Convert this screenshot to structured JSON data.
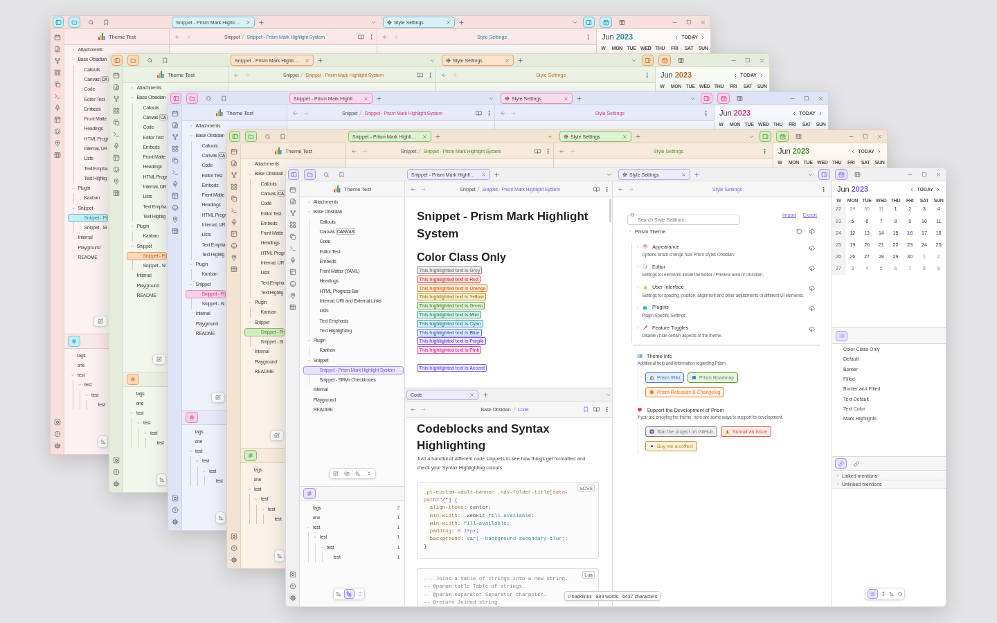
{
  "windows": [
    {
      "tab_bar": {
        "left_buttons": [
          {
            "selected": true
          },
          {
            "selected": true
          },
          {
            "selected": false
          },
          {
            "selected": false
          }
        ],
        "main_tab": "Snippet - Prism Mark Highli…",
        "side_tab": "Style Settings",
        "right_buttons": [
          {
            "selected": true
          },
          {
            "selected": true
          },
          {
            "selected": false
          }
        ]
      },
      "explorer": {
        "title": "Theme Test",
        "tree": [
          {
            "label": "Attachments",
            "expanded": false,
            "selected": false
          },
          {
            "label": "Base Obsidian",
            "expanded": true,
            "selected": false,
            "children": [
              {
                "label": "Callouts",
                "selected": false
              },
              {
                "label": "Canvas",
                "badge": "CA",
                "selected": false
              },
              {
                "label": "Code",
                "selected": false
              },
              {
                "label": "Editor Test",
                "selected": false
              },
              {
                "label": "Embeds",
                "selected": false
              },
              {
                "label": "Front Matte",
                "selected": false
              },
              {
                "label": "Headings",
                "selected": false
              },
              {
                "label": "HTML Progr",
                "selected": false
              },
              {
                "label": "Internal, UR",
                "selected": false
              },
              {
                "label": "Lists",
                "selected": false
              },
              {
                "label": "Text Empha",
                "selected": false
              },
              {
                "label": "Text Highlig",
                "selected": false
              }
            ]
          },
          {
            "label": "Plugin",
            "expanded": true,
            "selected": false,
            "children": [
              {
                "label": "Kanban",
                "selected": false
              }
            ]
          },
          {
            "label": "Snippet",
            "expanded": true,
            "selected": false,
            "children": [
              {
                "label": "Snippet - Pr",
                "selected": true
              },
              {
                "label": "Snippet - Sl",
                "selected": false
              }
            ]
          },
          {
            "label": "Internal",
            "selected": false
          },
          {
            "label": "Playground",
            "selected": false
          },
          {
            "label": "README",
            "selected": false
          }
        ]
      },
      "tags": {
        "tree": [
          {
            "label": "tags"
          },
          {
            "label": "one"
          },
          {
            "label": "test",
            "expanded": true,
            "children": [
              {
                "label": "test",
                "expanded": true,
                "children": [
                  {
                    "label": "test",
                    "expanded": true,
                    "children": [
                      {
                        "label": "test"
                      }
                    ]
                  }
                ]
              }
            ]
          }
        ],
        "toolbar": [
          {
            "selected": false
          }
        ]
      },
      "editor": {
        "breadcrumb": [
          "Snippet",
          "Snippet - Prism Mark Highlight System"
        ]
      },
      "settings": {
        "title": "Style Settings"
      },
      "calendar": {
        "month": "Jun",
        "year": "2023",
        "today": "TODAY",
        "weekdays": [
          "W",
          "MON",
          "TUE",
          "WED",
          "THU",
          "FRI",
          "SAT",
          "SUN"
        ]
      }
    },
    {
      "tab_bar": {
        "left_buttons": [
          {
            "selected": true
          },
          {
            "selected": true
          },
          {
            "selected": false
          },
          {
            "selected": false
          }
        ],
        "main_tab": "Snippet - Prism Mark Highli…",
        "side_tab": "Style Settings",
        "right_buttons": [
          {
            "selected": true
          },
          {
            "selected": true
          },
          {
            "selected": false
          }
        ]
      },
      "explorer": {
        "title": "Theme Test",
        "tree": [
          {
            "label": "Attachments",
            "expanded": false,
            "selected": false
          },
          {
            "label": "Base Obsidian",
            "expanded": true,
            "selected": false,
            "children": [
              {
                "label": "Callouts",
                "selected": false
              },
              {
                "label": "Canvas",
                "badge": "CA",
                "selected": false
              },
              {
                "label": "Code",
                "selected": false
              },
              {
                "label": "Editor Test",
                "selected": false
              },
              {
                "label": "Embeds",
                "selected": false
              },
              {
                "label": "Front Matte",
                "selected": false
              },
              {
                "label": "Headings",
                "selected": false
              },
              {
                "label": "HTML Progr",
                "selected": false
              },
              {
                "label": "Internal, UR",
                "selected": false
              },
              {
                "label": "Lists",
                "selected": false
              },
              {
                "label": "Text Empha",
                "selected": false
              },
              {
                "label": "Text Highlig",
                "selected": false
              }
            ]
          },
          {
            "label": "Plugin",
            "expanded": true,
            "selected": false,
            "children": [
              {
                "label": "Kanban",
                "selected": false
              }
            ]
          },
          {
            "label": "Snippet",
            "expanded": true,
            "selected": false,
            "children": [
              {
                "label": "Snippet - Pr",
                "selected": true
              },
              {
                "label": "Snippet - Sl",
                "selected": false
              }
            ]
          },
          {
            "label": "Internal",
            "selected": false
          },
          {
            "label": "Playground",
            "selected": false
          },
          {
            "label": "README",
            "selected": false
          }
        ]
      },
      "tags": {
        "tree": [
          {
            "label": "tags"
          },
          {
            "label": "one"
          },
          {
            "label": "test",
            "expanded": true,
            "children": [
              {
                "label": "test",
                "expanded": true,
                "children": [
                  {
                    "label": "test",
                    "expanded": true,
                    "children": [
                      {
                        "label": "test"
                      }
                    ]
                  }
                ]
              }
            ]
          }
        ],
        "toolbar": [
          {
            "selected": false
          }
        ]
      },
      "editor": {
        "breadcrumb": [
          "Snippet",
          "Snippet - Prism Mark Highlight System"
        ]
      },
      "settings": {
        "title": "Style Settings"
      },
      "calendar": {
        "month": "Jun",
        "year": "2023",
        "today": "TODAY",
        "weekdays": [
          "W",
          "MON",
          "TUE",
          "WED",
          "THU",
          "FRI",
          "SAT",
          "SUN"
        ]
      }
    },
    {
      "tab_bar": {
        "left_buttons": [
          {
            "selected": true
          },
          {
            "selected": true
          },
          {
            "selected": false
          },
          {
            "selected": false
          }
        ],
        "main_tab": "Snippet - Prism Mark Highli…",
        "side_tab": "Style Settings",
        "right_buttons": [
          {
            "selected": true
          },
          {
            "selected": true
          },
          {
            "selected": false
          }
        ]
      },
      "explorer": {
        "title": "Theme Test",
        "tree": [
          {
            "label": "Attachments",
            "expanded": false,
            "selected": false
          },
          {
            "label": "Base Obsidian",
            "expanded": true,
            "selected": false,
            "children": [
              {
                "label": "Callouts",
                "selected": false
              },
              {
                "label": "Canvas",
                "badge": "CA",
                "selected": false
              },
              {
                "label": "Code",
                "selected": false
              },
              {
                "label": "Editor Test",
                "selected": false
              },
              {
                "label": "Embeds",
                "selected": false
              },
              {
                "label": "Front Matte",
                "selected": false
              },
              {
                "label": "Headings",
                "selected": false
              },
              {
                "label": "HTML Progr",
                "selected": false
              },
              {
                "label": "Internal, UR",
                "selected": false
              },
              {
                "label": "Lists",
                "selected": false
              },
              {
                "label": "Text Empha",
                "selected": false
              },
              {
                "label": "Text Highlig",
                "selected": false
              }
            ]
          },
          {
            "label": "Plugin",
            "expanded": true,
            "selected": false,
            "children": [
              {
                "label": "Kanban",
                "selected": false
              }
            ]
          },
          {
            "label": "Snippet",
            "expanded": true,
            "selected": false,
            "children": [
              {
                "label": "Snippet - Pr",
                "selected": true
              },
              {
                "label": "Snippet - Sl",
                "selected": false
              }
            ]
          },
          {
            "label": "Internal",
            "selected": false
          },
          {
            "label": "Playground",
            "selected": false
          },
          {
            "label": "README",
            "selected": false
          }
        ]
      },
      "tags": {
        "tree": [
          {
            "label": "tags"
          },
          {
            "label": "one"
          },
          {
            "label": "test",
            "expanded": true,
            "children": [
              {
                "label": "test",
                "expanded": true,
                "children": [
                  {
                    "label": "test",
                    "expanded": true,
                    "children": [
                      {
                        "label": "test"
                      }
                    ]
                  }
                ]
              }
            ]
          }
        ],
        "toolbar": [
          {
            "selected": false
          }
        ]
      },
      "editor": {
        "breadcrumb": [
          "Snippet",
          "Snippet - Prism Mark Highlight System"
        ]
      },
      "settings": {
        "title": "Style Settings"
      },
      "calendar": {
        "month": "Jun",
        "year": "2023",
        "today": "TODAY",
        "weekdays": [
          "W",
          "MON",
          "TUE",
          "WED",
          "THU",
          "FRI",
          "SAT",
          "SUN"
        ]
      }
    },
    {
      "tab_bar": {
        "left_buttons": [
          {
            "selected": true
          },
          {
            "selected": true
          },
          {
            "selected": false
          },
          {
            "selected": false
          }
        ],
        "main_tab": "Snippet - Prism Mark Highli…",
        "side_tab": "Style Settings",
        "right_buttons": [
          {
            "selected": true
          },
          {
            "selected": true
          },
          {
            "selected": false
          }
        ]
      },
      "explorer": {
        "title": "Theme Test",
        "tree": [
          {
            "label": "Attachments",
            "expanded": false,
            "selected": false
          },
          {
            "label": "Base Obsidian",
            "expanded": true,
            "selected": false,
            "children": [
              {
                "label": "Callouts",
                "selected": false
              },
              {
                "label": "Canvas",
                "badge": "CA",
                "selected": false
              },
              {
                "label": "Code",
                "selected": false
              },
              {
                "label": "Editor Test",
                "selected": false
              },
              {
                "label": "Embeds",
                "selected": false
              },
              {
                "label": "Front Matte",
                "selected": false
              },
              {
                "label": "Headings",
                "selected": false
              },
              {
                "label": "HTML Progr",
                "selected": false
              },
              {
                "label": "Internal, UR",
                "selected": false
              },
              {
                "label": "Lists",
                "selected": false
              },
              {
                "label": "Text Empha",
                "selected": false
              },
              {
                "label": "Text Highlig",
                "selected": false
              }
            ]
          },
          {
            "label": "Plugin",
            "expanded": true,
            "selected": false,
            "children": [
              {
                "label": "Kanban",
                "selected": false
              }
            ]
          },
          {
            "label": "Snippet",
            "expanded": true,
            "selected": false,
            "children": [
              {
                "label": "Snippet - Pr",
                "selected": true
              },
              {
                "label": "Snippet - Sl",
                "selected": false
              }
            ]
          },
          {
            "label": "Internal",
            "selected": false
          },
          {
            "label": "Playground",
            "selected": false
          },
          {
            "label": "README",
            "selected": false
          }
        ]
      },
      "tags": {
        "tree": [
          {
            "label": "tags"
          },
          {
            "label": "one"
          },
          {
            "label": "test",
            "expanded": true,
            "children": [
              {
                "label": "test",
                "expanded": true,
                "children": [
                  {
                    "label": "test",
                    "expanded": true,
                    "children": [
                      {
                        "label": "test"
                      }
                    ]
                  }
                ]
              }
            ]
          }
        ],
        "toolbar": [
          {
            "selected": false
          }
        ]
      },
      "editor": {
        "breadcrumb": [
          "Snippet",
          "Snippet - Prism Mark Highlight System"
        ]
      },
      "settings": {
        "title": "Style Settings"
      },
      "calendar": {
        "month": "Jun",
        "year": "2023",
        "today": "TODAY",
        "weekdays": [
          "W",
          "MON",
          "TUE",
          "WED",
          "THU",
          "FRI",
          "SAT",
          "SUN"
        ]
      }
    },
    {
      "tab_bar": {
        "left_buttons": [
          {
            "selected": true
          },
          {
            "selected": true
          },
          {
            "selected": false
          },
          {
            "selected": false
          }
        ],
        "main_tab": "Snippet - Prism Mark Highli…",
        "side_tab": "Style Settings",
        "right_buttons": [
          {
            "selected": true
          },
          {
            "selected": true
          },
          {
            "selected": false
          }
        ]
      },
      "explorer": {
        "title": "Theme Test",
        "tree": [
          {
            "label": "Attachments",
            "expanded": false,
            "selected": false
          },
          {
            "label": "Base Obsidian",
            "expanded": true,
            "selected": false,
            "children": [
              {
                "label": "Callouts",
                "selected": false
              },
              {
                "label": "Canvas",
                "badge": "CANVAS",
                "selected": false
              },
              {
                "label": "Code",
                "selected": false
              },
              {
                "label": "Editor Test",
                "selected": false
              },
              {
                "label": "Embeds",
                "selected": false
              },
              {
                "label": "Front Matter (YAML)",
                "selected": false
              },
              {
                "label": "Headings",
                "selected": false
              },
              {
                "label": "HTML Progress Bar",
                "selected": false
              },
              {
                "label": "Internal, URI and External Links",
                "selected": false
              },
              {
                "label": "Lists",
                "selected": false
              },
              {
                "label": "Text Emphasis",
                "selected": false
              },
              {
                "label": "Text Highlighting",
                "selected": false
              }
            ]
          },
          {
            "label": "Plugin",
            "expanded": true,
            "selected": false,
            "children": [
              {
                "label": "Kanban",
                "selected": false
              }
            ]
          },
          {
            "label": "Snippet",
            "expanded": true,
            "selected": false,
            "children": [
              {
                "label": "Snippet - Prism Mark Highlight System",
                "selected": true
              },
              {
                "label": "Snippet - SlRvb Checkboxes",
                "selected": false
              }
            ]
          },
          {
            "label": "Internal",
            "selected": false
          },
          {
            "label": "Playground",
            "selected": false
          },
          {
            "label": "README",
            "selected": false
          }
        ]
      },
      "tags": {
        "tree": [
          {
            "label": "tags",
            "count": "2"
          },
          {
            "label": "one",
            "count": "1"
          },
          {
            "label": "test",
            "count": "1",
            "expanded": true,
            "children": [
              {
                "label": "test",
                "count": "1",
                "expanded": true,
                "children": [
                  {
                    "label": "test",
                    "count": "1",
                    "expanded": true,
                    "children": [
                      {
                        "label": "test",
                        "count": "1"
                      }
                    ]
                  }
                ]
              }
            ]
          }
        ],
        "toolbar": [
          {
            "selected": false
          },
          {
            "selected": true
          },
          {
            "selected": false
          }
        ]
      },
      "editor": {
        "breadcrumb": [
          "Snippet",
          "Snippet - Prism Mark Highlight System"
        ],
        "title": "Snippet - Prism Mark Highlight System",
        "heading": "Color Class Only",
        "highlight_groups": [
          [
            {
              "text": "This highlighted text is Grey",
              "color": "#8a8a8a"
            },
            {
              "text": "This highlighted text is Red",
              "color": "#e0574a"
            },
            {
              "text": "This highlighted text is Orange",
              "color": "#dd7a2a"
            },
            {
              "text": "This highlighted text is Yellow",
              "color": "#b8900f"
            },
            {
              "text": "This highlighted text is Green",
              "color": "#5a9a35"
            },
            {
              "text": "This highlighted text is Mint",
              "color": "#34a07e"
            },
            {
              "text": "This highlighted text is Cyan",
              "color": "#2a93ad"
            },
            {
              "text": "This highlighted text is Blue",
              "color": "#4a76dc"
            },
            {
              "text": "This highlighted text is Purple",
              "color": "#8559e6"
            },
            {
              "text": "This highlighted text is Pink",
              "color": "#d8509f"
            }
          ],
          [
            {
              "text": "This highlighted text is Accent",
              "color": "#7a6bef"
            }
          ]
        ]
      },
      "code_pane": {
        "tab": "Code",
        "breadcrumb": [
          "Base Obsidian",
          "Code"
        ],
        "bookmarked": true,
        "title": "Codeblocks and Syntax Highlighting",
        "intro": "Just a handful of different code snippets to see how things get formatted and check your Syntax Highlighting colours.",
        "blocks": [
          {
            "language": "SCSS",
            "lines": [
              [
                {
                  "kind": "selector",
                  "text": ".pt-custom-vault-banner .nav-folder-title["
                },
                {
                  "kind": "attribute",
                  "text": "data-"
                }
              ],
              [
                {
                  "kind": "attribute",
                  "text": "path"
                },
                {
                  "kind": "plain",
                  "text": "=\"/\"] {"
                }
              ],
              [
                {
                  "kind": "property",
                  "text": "  align-items"
                },
                {
                  "kind": "plain",
                  "text": ": center;"
                }
              ],
              [
                {
                  "kind": "property",
                  "text": "  min-width"
                },
                {
                  "kind": "plain",
                  "text": ": -webkit-"
                },
                {
                  "kind": "keyword",
                  "text": "fill-available"
                },
                {
                  "kind": "plain",
                  "text": ";"
                }
              ],
              [
                {
                  "kind": "property",
                  "text": "  min-width"
                },
                {
                  "kind": "plain",
                  "text": ": "
                },
                {
                  "kind": "keyword",
                  "text": "fill-available"
                },
                {
                  "kind": "plain",
                  "text": ";"
                }
              ],
              [
                {
                  "kind": "property",
                  "text": "  padding"
                },
                {
                  "kind": "plain",
                  "text": ": "
                },
                {
                  "kind": "number",
                  "text": "0 10px"
                },
                {
                  "kind": "plain",
                  "text": ";"
                }
              ],
              [
                {
                  "kind": "property",
                  "text": "  background"
                },
                {
                  "kind": "plain",
                  "text": ": "
                },
                {
                  "kind": "function",
                  "text": "var(--background-secondary-blur)"
                },
                {
                  "kind": "plain",
                  "text": ";"
                }
              ],
              [
                {
                  "kind": "plain",
                  "text": "}"
                }
              ]
            ]
          },
          {
            "language": "Lua",
            "lines": [
              [
                {
                  "kind": "comment",
                  "text": "--- Joins a table of strings into a new string."
                }
              ],
              [
                {
                  "kind": "comment",
                  "text": "-- @param table Table of strings."
                }
              ],
              [
                {
                  "kind": "comment",
                  "text": "-- @param separator Separator character."
                }
              ],
              [
                {
                  "kind": "comment",
                  "text": "-- @return Joined string."
                }
              ]
            ]
          }
        ]
      },
      "settings": {
        "title": "Style Settings",
        "search": {
          "placeholder": "Search Style Settings..."
        },
        "links": [
          "Import",
          "Export"
        ],
        "section": {
          "title": "Prism Theme",
          "expanded": true,
          "items": [
            {
              "kind": "palette",
              "title": "Appearance",
              "description": "Options which change how Prism styles Obsidian.",
              "expanded": false
            },
            {
              "kind": "editor",
              "title": "Editor",
              "description": "Settings for elements inside the Editor / Preview area of Obsidian.",
              "expanded": false
            },
            {
              "kind": "interface",
              "title": "User Interface",
              "description": "Settings for spacing, position, alignment and other adjustments of different UI elements.",
              "expanded": false
            },
            {
              "kind": "plugins",
              "title": "Plugins",
              "description": "Plugin Specific Settings.",
              "expanded": false
            },
            {
              "kind": "toggles",
              "title": "Feature Toggles",
              "description": "Disable / hide certain aspects of the theme.",
              "expanded": false
            }
          ]
        },
        "info": [
          {
            "kind": "book",
            "title": "Theme Info",
            "description": "Additional help and information regarding Prism.",
            "button_rows": [
              [
                {
                  "kind": "wiki",
                  "label": "Prism Wiki",
                  "color": "#4a78d8"
                },
                {
                  "kind": "roadmap",
                  "label": "Prism Roadmap",
                  "color": "#5a9a3a"
                }
              ],
              [
                {
                  "kind": "releases",
                  "label": "Prism Releases & Changelog",
                  "color": "#e0853a"
                }
              ]
            ]
          },
          {
            "kind": "heart",
            "title": "Support the Development of Prism",
            "description": "If you are enjoying the theme, here are some ways to support its development.",
            "button_rows": [
              [
                {
                  "kind": "github",
                  "label": "Star the project on GitHub",
                  "color": "#7a7a7a"
                },
                {
                  "kind": "issue",
                  "label": "Submit an Issue",
                  "color": "#e0554a"
                }
              ],
              [
                {
                  "kind": "coffee",
                  "label": "Buy me a coffee!",
                  "color": "#c4921f"
                }
              ]
            ]
          }
        ]
      },
      "calendar": {
        "month": "Jun",
        "year": "2023",
        "today": "TODAY",
        "weekdays": [
          "W",
          "MON",
          "TUE",
          "WED",
          "THU",
          "FRI",
          "SAT",
          "SUN"
        ],
        "weeks": [
          {
            "week": "22",
            "days": [
              {
                "day": "29",
                "outside": true,
                "today": false
              },
              {
                "day": "30",
                "outside": true,
                "today": false
              },
              {
                "day": "31",
                "outside": true,
                "today": false
              },
              {
                "day": "1",
                "outside": false,
                "today": false
              },
              {
                "day": "2",
                "outside": false,
                "today": false
              },
              {
                "day": "3",
                "outside": false,
                "today": false
              },
              {
                "day": "4",
                "outside": false,
                "today": false
              }
            ]
          },
          {
            "week": "23",
            "days": [
              {
                "day": "5",
                "outside": false,
                "today": false
              },
              {
                "day": "6",
                "outside": false,
                "today": false
              },
              {
                "day": "7",
                "outside": false,
                "today": false
              },
              {
                "day": "8",
                "outside": false,
                "today": false
              },
              {
                "day": "9",
                "outside": false,
                "today": false
              },
              {
                "day": "10",
                "outside": false,
                "today": false
              },
              {
                "day": "11",
                "outside": false,
                "today": false
              }
            ]
          },
          {
            "week": "24",
            "days": [
              {
                "day": "12",
                "outside": false,
                "today": false
              },
              {
                "day": "13",
                "outside": false,
                "today": false
              },
              {
                "day": "14",
                "outside": false,
                "today": false
              },
              {
                "day": "15",
                "outside": false,
                "today": false
              },
              {
                "day": "16",
                "outside": false,
                "today": true
              },
              {
                "day": "17",
                "outside": false,
                "today": false
              },
              {
                "day": "18",
                "outside": false,
                "today": false
              }
            ]
          },
          {
            "week": "25",
            "days": [
              {
                "day": "19",
                "outside": false,
                "today": false
              },
              {
                "day": "20",
                "outside": false,
                "today": false
              },
              {
                "day": "21",
                "outside": false,
                "today": false
              },
              {
                "day": "22",
                "outside": false,
                "today": false
              },
              {
                "day": "23",
                "outside": false,
                "today": false
              },
              {
                "day": "24",
                "outside": false,
                "today": false
              },
              {
                "day": "25",
                "outside": false,
                "today": false
              }
            ]
          },
          {
            "week": "26",
            "days": [
              {
                "day": "26",
                "outside": false,
                "today": false
              },
              {
                "day": "27",
                "outside": false,
                "today": false
              },
              {
                "day": "28",
                "outside": false,
                "today": false
              },
              {
                "day": "29",
                "outside": false,
                "today": false
              },
              {
                "day": "30",
                "outside": false,
                "today": false
              },
              {
                "day": "1",
                "outside": true,
                "today": false
              },
              {
                "day": "2",
                "outside": true,
                "today": false
              }
            ]
          },
          {
            "week": "27",
            "days": [
              {
                "day": "3",
                "outside": true,
                "today": false
              },
              {
                "day": "4",
                "outside": true,
                "today": false
              },
              {
                "day": "5",
                "outside": true,
                "today": false
              },
              {
                "day": "6",
                "outside": true,
                "today": false
              },
              {
                "day": "7",
                "outside": true,
                "today": false
              },
              {
                "day": "8",
                "outside": true,
                "today": false
              },
              {
                "day": "9",
                "outside": true,
                "today": false
              }
            ]
          }
        ]
      },
      "outline": [
        "Color Class Only",
        "Default",
        "Border",
        "Filled",
        "Border and Filled",
        "Text Default",
        "Text Color",
        "Mark Highlights"
      ],
      "backlinks": {
        "buttons": [
          {
            "selected": true
          },
          {
            "selected": false
          }
        ],
        "sections": [
          {
            "label": "Linked mentions",
            "expanded": false
          },
          {
            "label": "Unlinked mentions",
            "expanded": false
          }
        ]
      },
      "right_toolbar": [
        {
          "selected": true
        },
        {
          "selected": false
        },
        {
          "selected": false
        },
        {
          "selected": false
        }
      ],
      "status_bar": [
        "0 backlinks",
        "899 words",
        "6437 characters"
      ]
    }
  ]
}
